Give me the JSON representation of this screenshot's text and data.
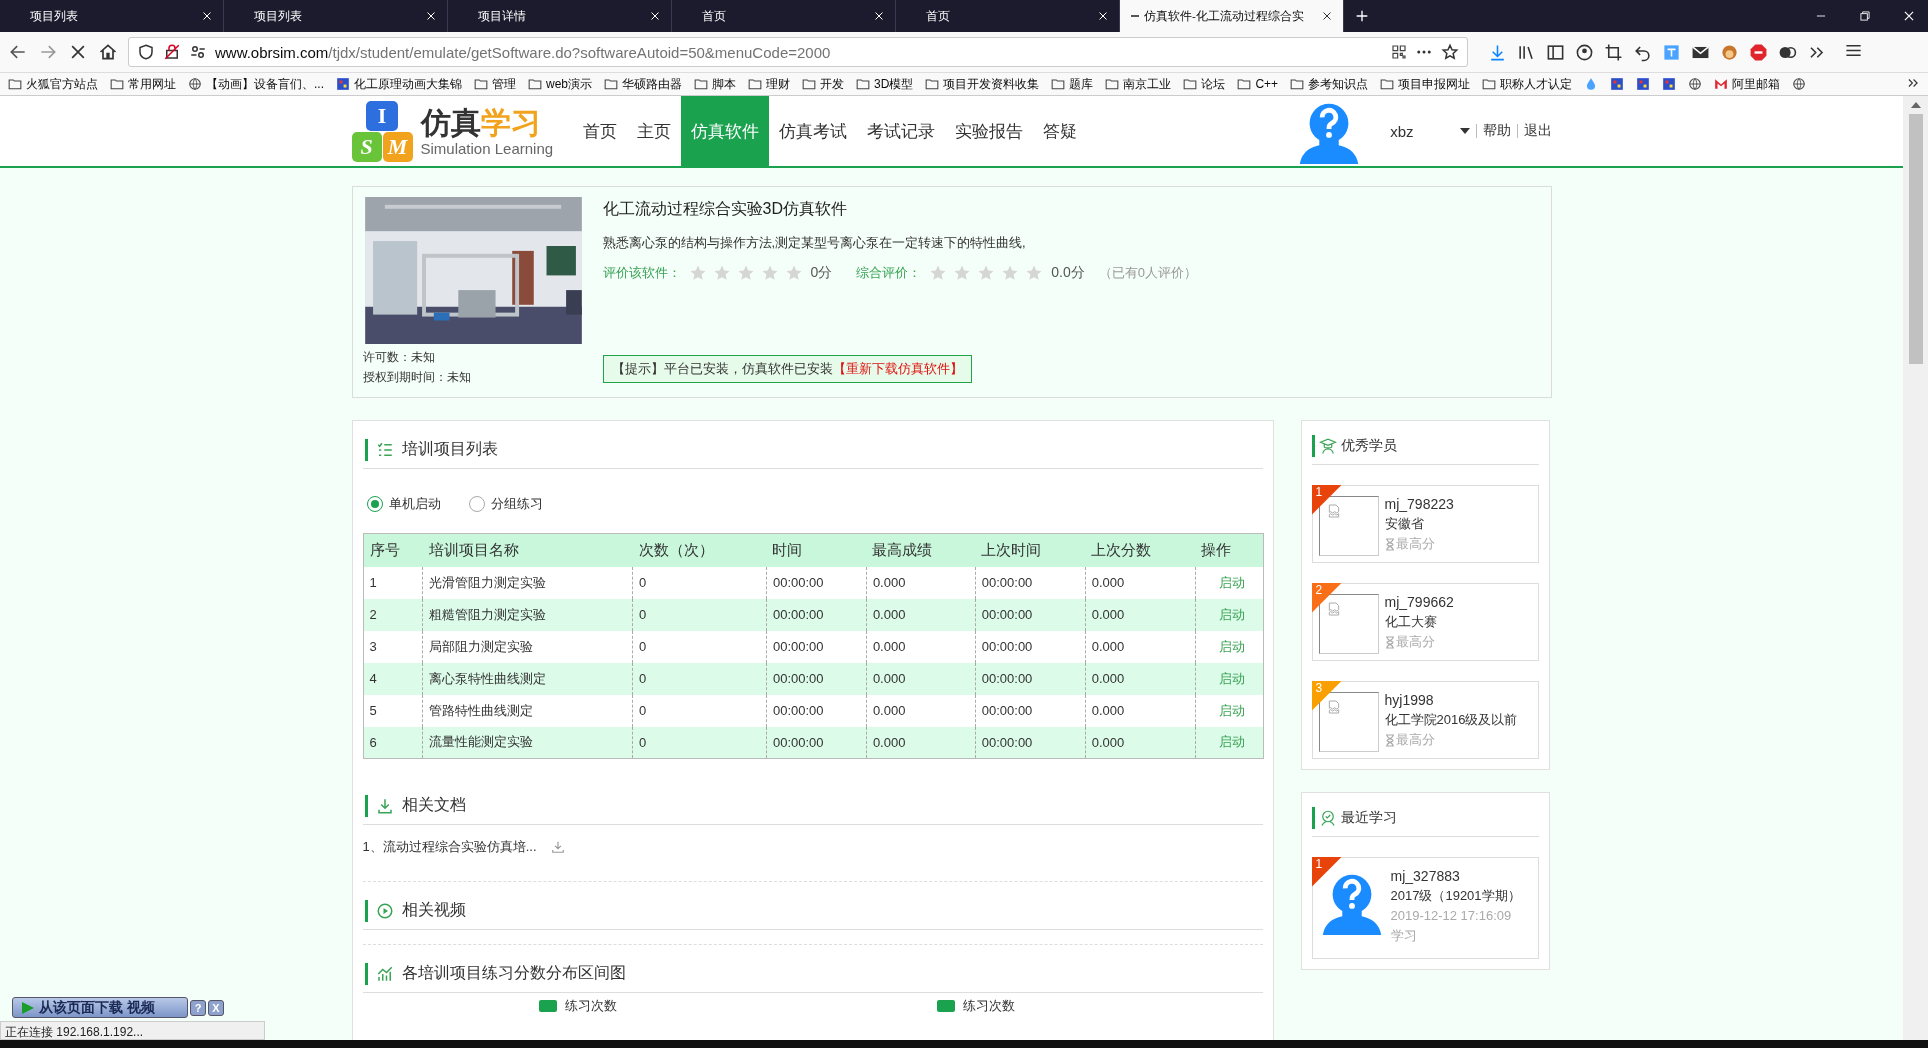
{
  "browser": {
    "tabs": [
      {
        "title": "项目列表",
        "selected": false
      },
      {
        "title": "项目列表",
        "selected": false
      },
      {
        "title": "项目详情",
        "selected": false
      },
      {
        "title": "首页",
        "selected": false
      },
      {
        "title": "首页",
        "selected": false
      },
      {
        "title": "仿真软件-化工流动过程综合实",
        "selected": true
      }
    ],
    "address": {
      "host": "www.obrsim.com",
      "path": "/tjdx/student/emulate/getSoftware.do?softwareAutoid=50&menuCode=2000"
    },
    "bookmarks": [
      {
        "label": "火狐官方站点",
        "kind": "folder"
      },
      {
        "label": "常用网址",
        "kind": "folder"
      },
      {
        "label": "【动画】设备盲们、...",
        "kind": "globe"
      },
      {
        "label": "化工原理动画大集锦",
        "kind": "app"
      },
      {
        "label": "管理",
        "kind": "folder"
      },
      {
        "label": "web演示",
        "kind": "folder"
      },
      {
        "label": "华硕路由器",
        "kind": "folder"
      },
      {
        "label": "脚本",
        "kind": "folder"
      },
      {
        "label": "理财",
        "kind": "folder"
      },
      {
        "label": "开发",
        "kind": "folder"
      },
      {
        "label": "3D模型",
        "kind": "folder"
      },
      {
        "label": "项目开发资料收集",
        "kind": "folder"
      },
      {
        "label": "题库",
        "kind": "folder"
      },
      {
        "label": "南京工业",
        "kind": "folder"
      },
      {
        "label": "论坛",
        "kind": "folder"
      },
      {
        "label": "C++",
        "kind": "folder"
      },
      {
        "label": "参考知识点",
        "kind": "folder"
      },
      {
        "label": "项目申报网址",
        "kind": "folder"
      },
      {
        "label": "职称人才认定",
        "kind": "folder"
      },
      {
        "kind": "drop"
      },
      {
        "kind": "app"
      },
      {
        "kind": "app"
      },
      {
        "kind": "app"
      },
      {
        "kind": "globe"
      },
      {
        "label": "阿里邮箱",
        "kind": "mail"
      },
      {
        "kind": "globe"
      }
    ]
  },
  "header": {
    "logo": {
      "letters": [
        "I",
        "S",
        "M"
      ],
      "title_a": "仿真",
      "title_b": "学习",
      "subtitle": "Simulation Learning"
    },
    "nav": [
      {
        "label": "首页",
        "selected": false
      },
      {
        "label": "主页",
        "selected": false
      },
      {
        "label": "仿真软件",
        "selected": true
      },
      {
        "label": "仿真考试",
        "selected": false
      },
      {
        "label": "考试记录",
        "selected": false
      },
      {
        "label": "实验报告",
        "selected": false
      },
      {
        "label": "答疑",
        "selected": false
      }
    ],
    "user": "xbz",
    "links": [
      "帮助",
      "退出"
    ]
  },
  "product": {
    "title": "化工流动过程综合实验3D仿真软件",
    "description": "熟悉离心泵的结构与操作方法,测定某型号离心泵在一定转速下的特性曲线,",
    "license": "许可数：未知",
    "expiry": "授权到期时间：未知",
    "ratings": [
      {
        "label": "评价该软件：",
        "stars": 0,
        "score": "0分"
      },
      {
        "label": "综合评价：",
        "stars": 0,
        "score": "0.0分",
        "note": "（已有0人评价）"
      }
    ],
    "notice": {
      "text": "【提示】平台已安装，仿真软件已安装",
      "link": "【重新下载仿真软件】"
    }
  },
  "training": {
    "title": "培训项目列表",
    "modes": [
      {
        "label": "单机启动",
        "selected": true
      },
      {
        "label": "分组练习",
        "selected": false
      }
    ],
    "table": {
      "columns": [
        "序号",
        "培训项目名称",
        "次数（次）",
        "时间",
        "最高成绩",
        "上次时间",
        "上次分数",
        "操作"
      ],
      "rows": [
        [
          "1",
          "光滑管阻力测定实验",
          "0",
          "00:00:00",
          "0.000",
          "00:00:00",
          "0.000",
          "启动"
        ],
        [
          "2",
          "粗糙管阻力测定实验",
          "0",
          "00:00:00",
          "0.000",
          "00:00:00",
          "0.000",
          "启动"
        ],
        [
          "3",
          "局部阻力测定实验",
          "0",
          "00:00:00",
          "0.000",
          "00:00:00",
          "0.000",
          "启动"
        ],
        [
          "4",
          "离心泵特性曲线测定",
          "0",
          "00:00:00",
          "0.000",
          "00:00:00",
          "0.000",
          "启动"
        ],
        [
          "5",
          "管路特性曲线测定",
          "0",
          "00:00:00",
          "0.000",
          "00:00:00",
          "0.000",
          "启动"
        ],
        [
          "6",
          "流量性能测定实验",
          "0",
          "00:00:00",
          "0.000",
          "00:00:00",
          "0.000",
          "启动"
        ]
      ]
    }
  },
  "documents": {
    "title": "相关文档",
    "items": [
      "1、流动过程综合实验仿真培..."
    ]
  },
  "videos": {
    "title": "相关视频"
  },
  "distribution": {
    "title": "各培训项目练习分数分布区间图",
    "legends": [
      "练习次数",
      "练习次数"
    ]
  },
  "top_students": {
    "title": "优秀学员",
    "items": [
      {
        "rank": "1",
        "name": "mj_798223",
        "group": "安徽省",
        "score_label": "最高分",
        "color": "#e8430b"
      },
      {
        "rank": "2",
        "name": "mj_799662",
        "group": "化工大赛",
        "score_label": "最高分",
        "color": "#f86f18"
      },
      {
        "rank": "3",
        "name": "hyj1998",
        "group": "化工学院2016级及以前",
        "score_label": "最高分",
        "color": "#f9a000"
      }
    ]
  },
  "recent": {
    "title": "最近学习",
    "items": [
      {
        "rank": "1",
        "name": "mj_327883",
        "group": "2017级（19201学期）",
        "time": "2019-12-12 17:16:09",
        "activity": "学习",
        "color": "#e8430b"
      }
    ]
  },
  "download_bar": {
    "label": "从该页面下载 视频",
    "help": "?",
    "close": "X"
  },
  "status_bar": "正在连接 192.168.1.192..."
}
